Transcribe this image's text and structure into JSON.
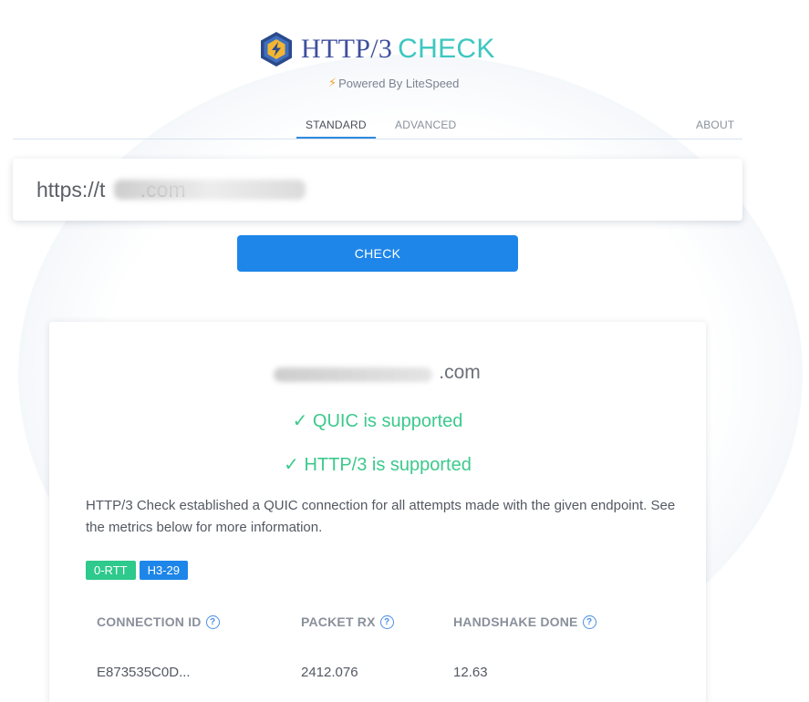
{
  "header": {
    "logo_title_part1": "HTTP/3",
    "logo_title_part2": "CHECK",
    "powered_by": "Powered By LiteSpeed",
    "colors": {
      "title_dark": "#3f4f9e",
      "title_teal": "#3cc7c0",
      "accent": "#1e86e9",
      "success": "#3cc98c"
    }
  },
  "tabs": [
    {
      "label": "STANDARD"
    },
    {
      "label": "ADVANCED"
    },
    {
      "label": "ABOUT"
    }
  ],
  "search": {
    "value": "https://t      .com"
  },
  "check_button": {
    "label": "CHECK"
  },
  "result": {
    "domain": ".com",
    "quic_status": "✓ QUIC is supported",
    "http3_status": "✓ HTTP/3 is supported",
    "description": "HTTP/3 Check established a QUIC connection for all attempts made with the given endpoint. See the metrics below for more information.",
    "badges": [
      {
        "label": "0-RTT"
      },
      {
        "label": "H3-29"
      }
    ],
    "table": {
      "headers": [
        "CONNECTION ID",
        "PACKET RX",
        "HANDSHAKE DONE"
      ],
      "row": [
        "E873535C0D...",
        "2412.076",
        "12.63"
      ]
    }
  }
}
